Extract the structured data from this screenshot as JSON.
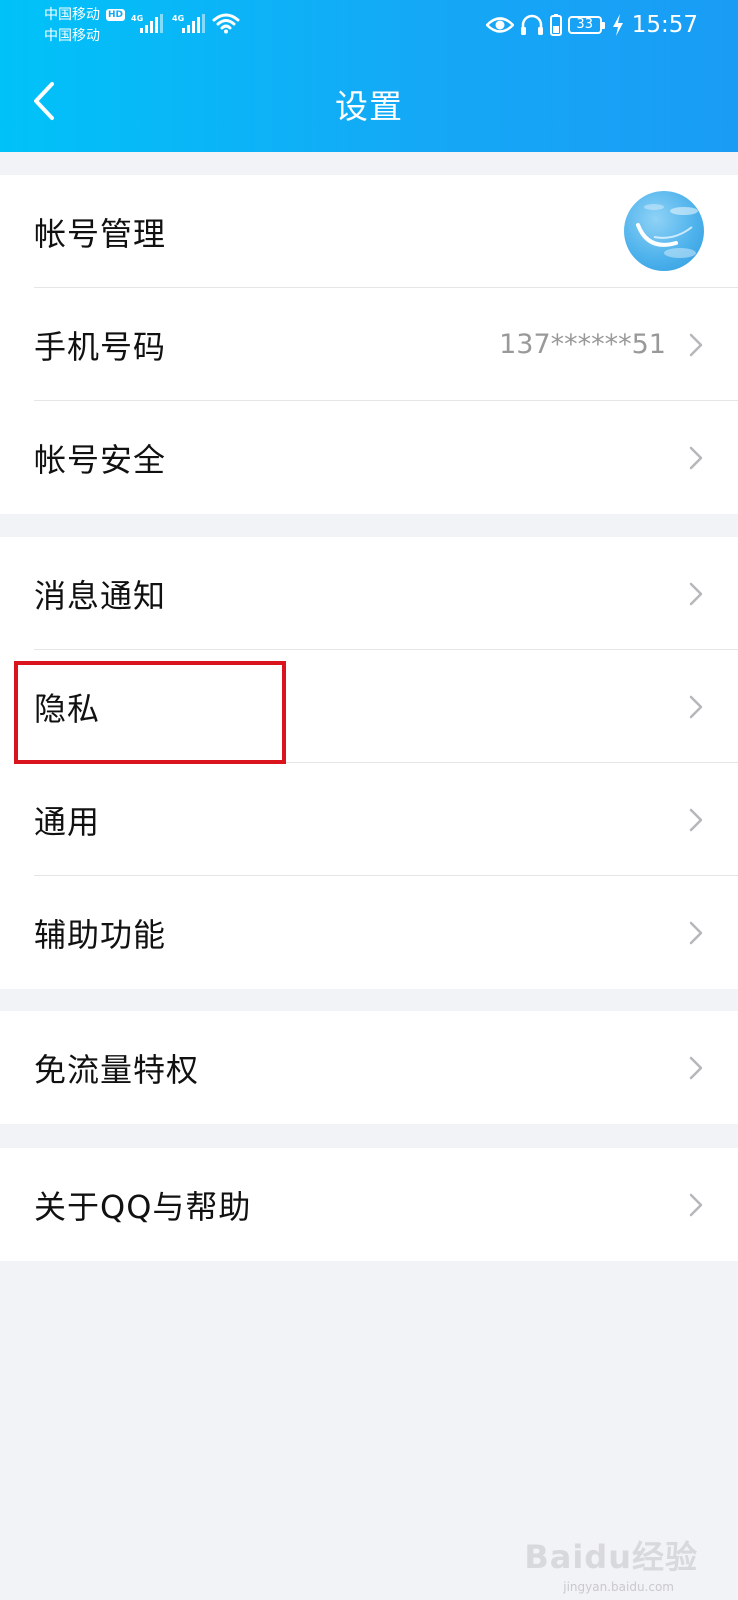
{
  "status_bar": {
    "carrier_1": "中国移动",
    "carrier_2": "中国移动",
    "hd_badge": "HD",
    "signal_label": "4G",
    "battery": "33",
    "time": "15:57"
  },
  "header": {
    "title": "设置"
  },
  "groups": [
    {
      "items": [
        {
          "label": "帐号管理"
        },
        {
          "label": "手机号码",
          "value": "137******51"
        },
        {
          "label": "帐号安全"
        }
      ]
    },
    {
      "items": [
        {
          "label": "消息通知"
        },
        {
          "label": "隐私"
        },
        {
          "label": "通用"
        },
        {
          "label": "辅助功能"
        }
      ]
    },
    {
      "items": [
        {
          "label": "免流量特权"
        }
      ]
    },
    {
      "items": [
        {
          "label": "关于QQ与帮助"
        }
      ]
    }
  ],
  "annotation": {
    "highlighted_item": "隐私",
    "color": "#d9141c"
  },
  "watermark": {
    "brand": "Baidu经验",
    "sub": "jingyan.baidu.com"
  },
  "colors": {
    "header_start": "#00c2f8",
    "header_end": "#1a9cf5",
    "background": "#f2f3f7"
  }
}
